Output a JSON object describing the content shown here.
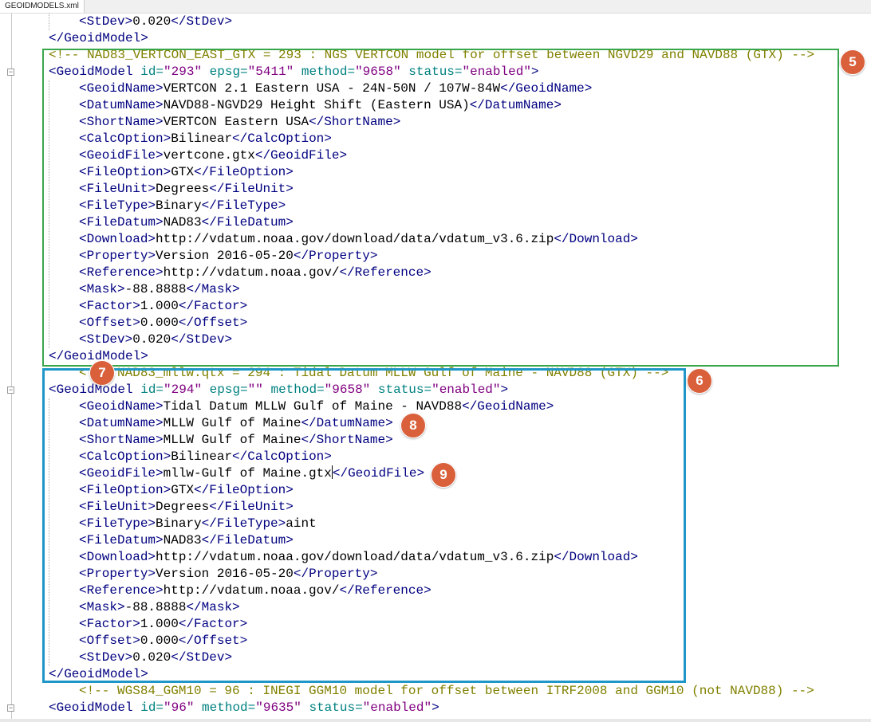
{
  "tab": {
    "label": "GEOIDMODELS.xml"
  },
  "colors": {
    "tag": "#000080",
    "attr": "#008080",
    "value": "#800080",
    "comment": "#808000",
    "green_box": "#3aa64c",
    "blue_box": "#1e96c8",
    "badge": "#d9603b"
  },
  "badges": [
    "5",
    "6",
    "7",
    "8",
    "9"
  ],
  "editor": {
    "lines": [
      {
        "indent": 1,
        "text": "<StDev>0.020</StDev>"
      },
      {
        "indent": 0,
        "text": "</GeoidModel>"
      },
      {
        "indent": 0,
        "text": "<!-- NAD83_VERTCON_EAST_GTX = 293 : NGS VERTCON model for offset between NGVD29 and NAVD88 (GTX) -->"
      },
      {
        "indent": 0,
        "text": "<GeoidModel id=\"293\" epsg=\"5411\" method=\"9658\" status=\"enabled\">"
      },
      {
        "indent": 1,
        "text": "<GeoidName>VERTCON 2.1 Eastern USA - 24N-50N / 107W-84W</GeoidName>"
      },
      {
        "indent": 1,
        "text": "<DatumName>NAVD88-NGVD29 Height Shift (Eastern USA)</DatumName>"
      },
      {
        "indent": 1,
        "text": "<ShortName>VERTCON Eastern USA</ShortName>"
      },
      {
        "indent": 1,
        "text": "<CalcOption>Bilinear</CalcOption>"
      },
      {
        "indent": 1,
        "text": "<GeoidFile>vertcone.gtx</GeoidFile>"
      },
      {
        "indent": 1,
        "text": "<FileOption>GTX</FileOption>"
      },
      {
        "indent": 1,
        "text": "<FileUnit>Degrees</FileUnit>"
      },
      {
        "indent": 1,
        "text": "<FileType>Binary</FileType>"
      },
      {
        "indent": 1,
        "text": "<FileDatum>NAD83</FileDatum>"
      },
      {
        "indent": 1,
        "text": "<Download>http://vdatum.noaa.gov/download/data/vdatum_v3.6.zip</Download>"
      },
      {
        "indent": 1,
        "text": "<Property>Version 2016-05-20</Property>"
      },
      {
        "indent": 1,
        "text": "<Reference>http://vdatum.noaa.gov/</Reference>"
      },
      {
        "indent": 1,
        "text": "<Mask>-88.8888</Mask>"
      },
      {
        "indent": 1,
        "text": "<Factor>1.000</Factor>"
      },
      {
        "indent": 1,
        "text": "<Offset>0.000</Offset>"
      },
      {
        "indent": 1,
        "text": "<StDev>0.020</StDev>"
      },
      {
        "indent": 0,
        "text": "</GeoidModel>"
      },
      {
        "indent": 1,
        "text": "<!-- NAD83_mllw.qtx = 294 : Tidal Datum MLLW Gulf of Maine - NAVD88 (GTX) -->"
      },
      {
        "indent": 0,
        "text": "<GeoidModel id=\"294\" epsg=\"\" method=\"9658\" status=\"enabled\">"
      },
      {
        "indent": 1,
        "text": "<GeoidName>Tidal Datum MLLW Gulf of Maine - NAVD88</GeoidName>"
      },
      {
        "indent": 1,
        "text": "<DatumName>MLLW Gulf of Maine</DatumName>"
      },
      {
        "indent": 1,
        "text": "<ShortName>MLLW Gulf of Maine</ShortName>"
      },
      {
        "indent": 1,
        "text": "<CalcOption>Bilinear</CalcOption>"
      },
      {
        "indent": 1,
        "text": "<GeoidFile>mllw-Gulf of Maine.gtx</GeoidFile>",
        "caret_after": "mllw-Gulf of Maine.gtx"
      },
      {
        "indent": 1,
        "text": "<FileOption>GTX</FileOption>"
      },
      {
        "indent": 1,
        "text": "<FileUnit>Degrees</FileUnit>"
      },
      {
        "indent": 1,
        "text": "<FileType>Binary</FileType>aint"
      },
      {
        "indent": 1,
        "text": "<FileDatum>NAD83</FileDatum>"
      },
      {
        "indent": 1,
        "text": "<Download>http://vdatum.noaa.gov/download/data/vdatum_v3.6.zip</Download>"
      },
      {
        "indent": 1,
        "text": "<Property>Version 2016-05-20</Property>"
      },
      {
        "indent": 1,
        "text": "<Reference>http://vdatum.noaa.gov/</Reference>"
      },
      {
        "indent": 1,
        "text": "<Mask>-88.8888</Mask>"
      },
      {
        "indent": 1,
        "text": "<Factor>1.000</Factor>"
      },
      {
        "indent": 1,
        "text": "<Offset>0.000</Offset>"
      },
      {
        "indent": 1,
        "text": "<StDev>0.020</StDev>"
      },
      {
        "indent": 0,
        "text": "</GeoidModel>"
      },
      {
        "indent": 1,
        "text": "<!-- WGS84_GGM10 = 96 : INEGI GGM10 model for offset between ITRF2008 and GGM10 (not NAVD88) -->"
      },
      {
        "indent": 0,
        "text": "<GeoidModel id=\"96\" method=\"9635\" status=\"enabled\">"
      }
    ]
  }
}
